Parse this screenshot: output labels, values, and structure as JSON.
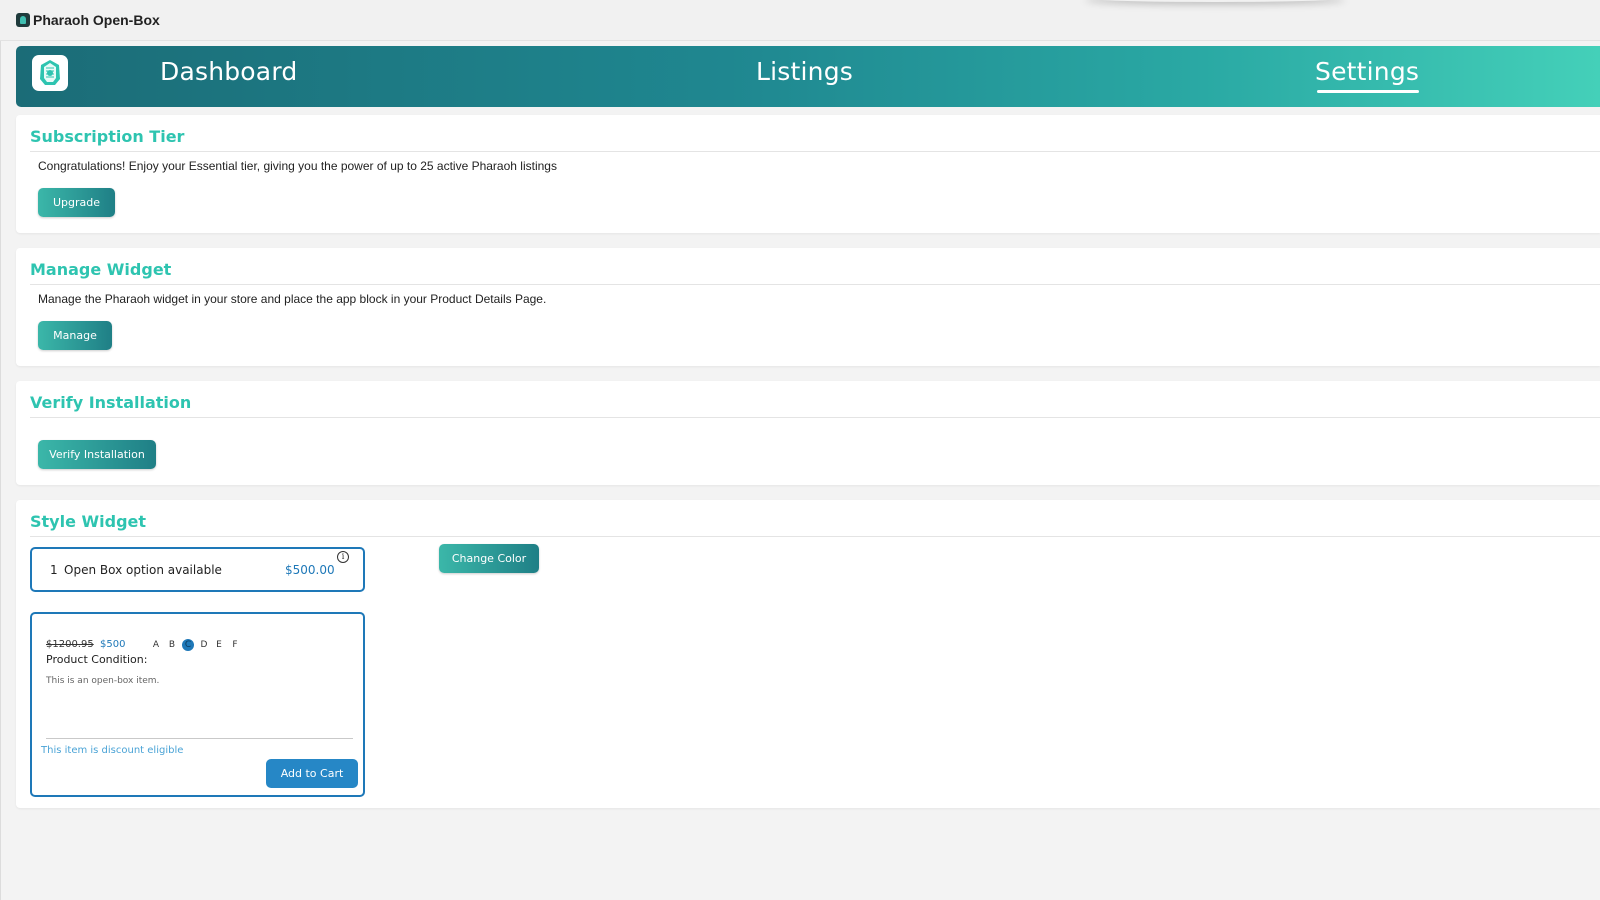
{
  "window": {
    "app_title": "Pharaoh Open-Box"
  },
  "nav": {
    "items": [
      {
        "label": "Dashboard"
      },
      {
        "label": "Listings"
      },
      {
        "label": "Settings",
        "active": true
      }
    ]
  },
  "subscription": {
    "title": "Subscription Tier",
    "text": "Congratulations! Enjoy your Essential tier, giving you the power of up to 25 active Pharaoh listings",
    "button": "Upgrade"
  },
  "widget": {
    "title": "Manage Widget",
    "text": "Manage the Pharaoh widget in your store and place the app block in your Product Details Page.",
    "button": "Manage"
  },
  "verify": {
    "title": "Verify Installation",
    "button": "Verify Installation"
  },
  "style": {
    "title": "Style Widget",
    "change_color_button": "Change Color",
    "preview_bar": {
      "count": "1",
      "label": "Open Box option available",
      "price": "$500.00",
      "info_glyph": "i"
    },
    "preview_card": {
      "old_price": "$1200.95",
      "new_price": "$500",
      "grades": [
        "A",
        "B",
        "C",
        "D",
        "E",
        "F"
      ],
      "selected_grade": "C",
      "condition_label": "Product Condition:",
      "condition_desc": "This is an open-box item.",
      "eligible_text": "This item is discount eligible",
      "cart_button": "Add to Cart"
    }
  },
  "colors": {
    "accent": "#2ec4b0",
    "primary_blue": "#1e78b8",
    "nav_gradient_start": "#1b6c77",
    "nav_gradient_end": "#44d0b9"
  }
}
